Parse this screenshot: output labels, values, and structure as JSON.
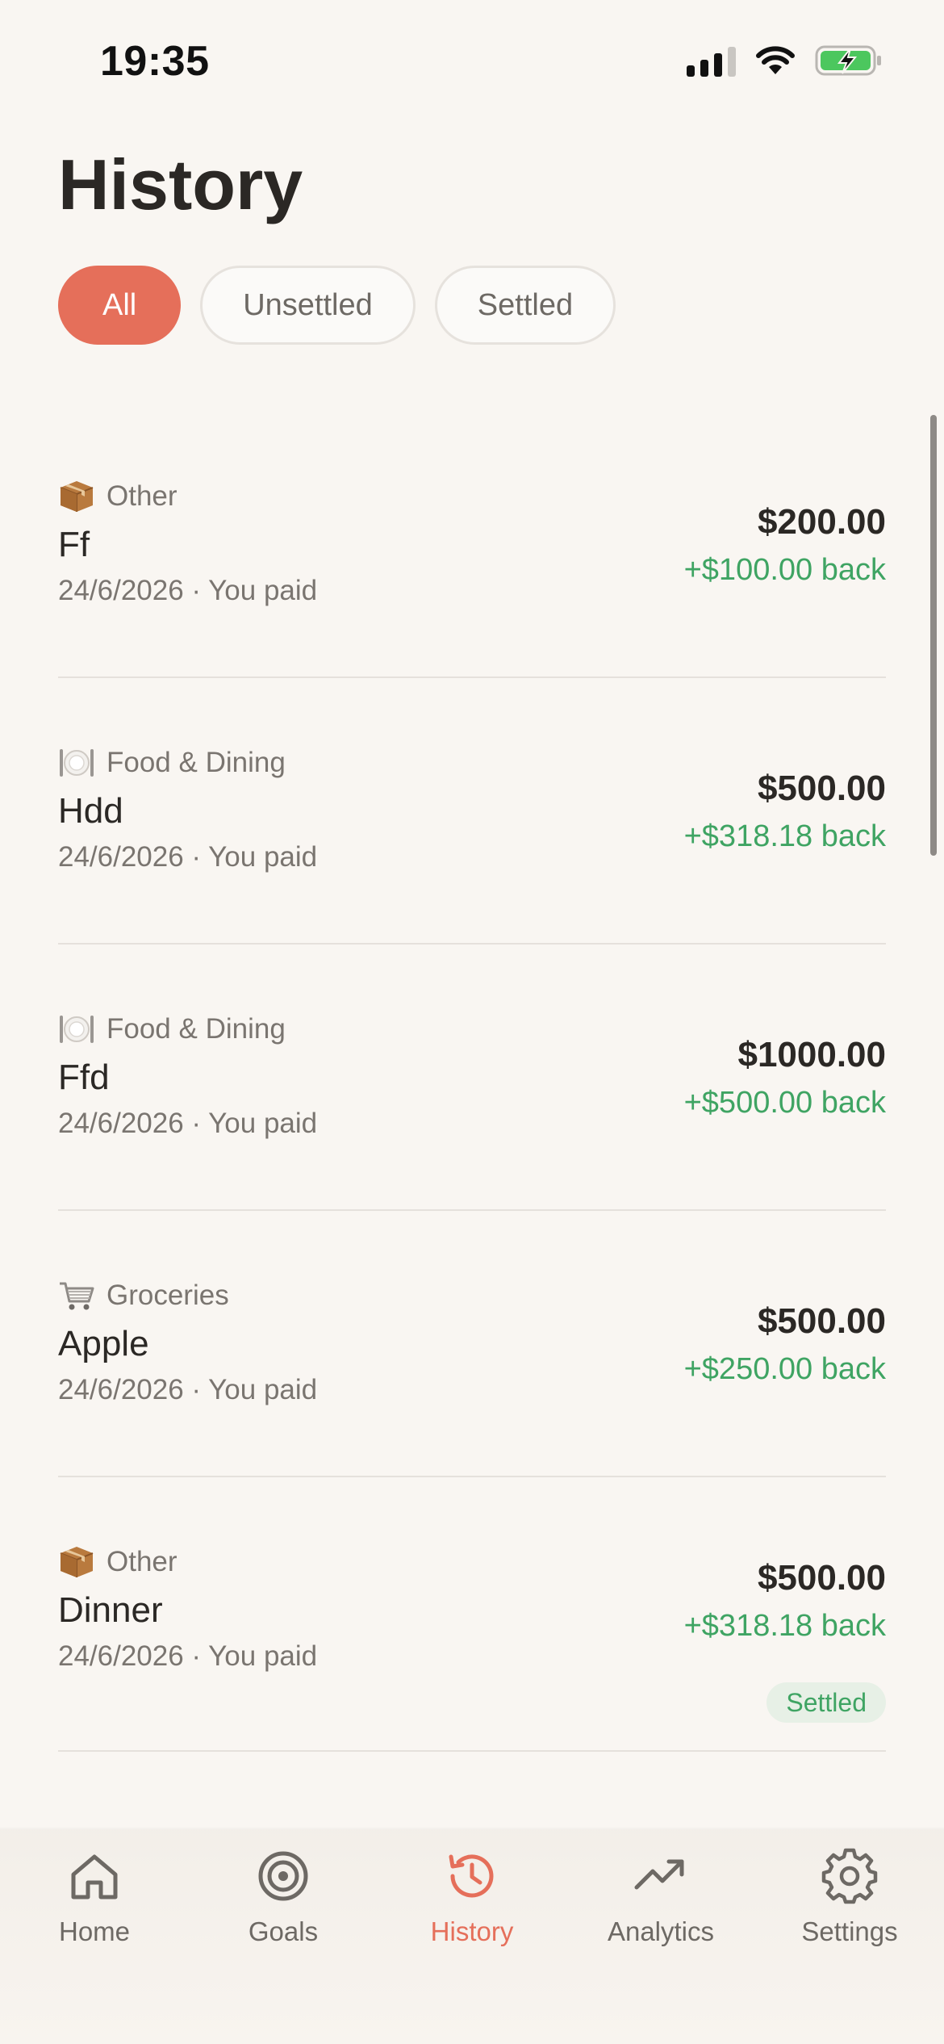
{
  "status_bar": {
    "time": "19:35"
  },
  "header": {
    "title": "History"
  },
  "filters": [
    {
      "label": "All",
      "active": true
    },
    {
      "label": "Unsettled",
      "active": false
    },
    {
      "label": "Settled",
      "active": false
    }
  ],
  "transactions": [
    {
      "category": "Other",
      "category_icon": "package-icon",
      "name": "Ff",
      "meta": "24/6/2026 · You paid",
      "amount": "$200.00",
      "back": "+$100.00 back"
    },
    {
      "category": "Food & Dining",
      "category_icon": "plate-icon",
      "name": "Hdd",
      "meta": "24/6/2026 · You paid",
      "amount": "$500.00",
      "back": "+$318.18 back"
    },
    {
      "category": "Food & Dining",
      "category_icon": "plate-icon",
      "name": "Ffd",
      "meta": "24/6/2026 · You paid",
      "amount": "$1000.00",
      "back": "+$500.00 back"
    },
    {
      "category": "Groceries",
      "category_icon": "cart-icon",
      "name": "Apple",
      "meta": "24/6/2026 · You paid",
      "amount": "$500.00",
      "back": "+$250.00 back"
    },
    {
      "category": "Other",
      "category_icon": "package-icon",
      "name": "Dinner",
      "meta": "24/6/2026 · You paid",
      "amount": "$500.00",
      "back": "+$318.18 back",
      "status": "Settled"
    }
  ],
  "tab_bar": {
    "items": [
      {
        "label": "Home",
        "icon": "home-icon"
      },
      {
        "label": "Goals",
        "icon": "target-icon"
      },
      {
        "label": "History",
        "icon": "history-icon",
        "active": true
      },
      {
        "label": "Analytics",
        "icon": "trend-up-icon"
      },
      {
        "label": "Settings",
        "icon": "gear-icon"
      }
    ]
  },
  "colors": {
    "accent": "#e56f5a",
    "positive": "#3fa463",
    "background": "#f9f6f2"
  }
}
